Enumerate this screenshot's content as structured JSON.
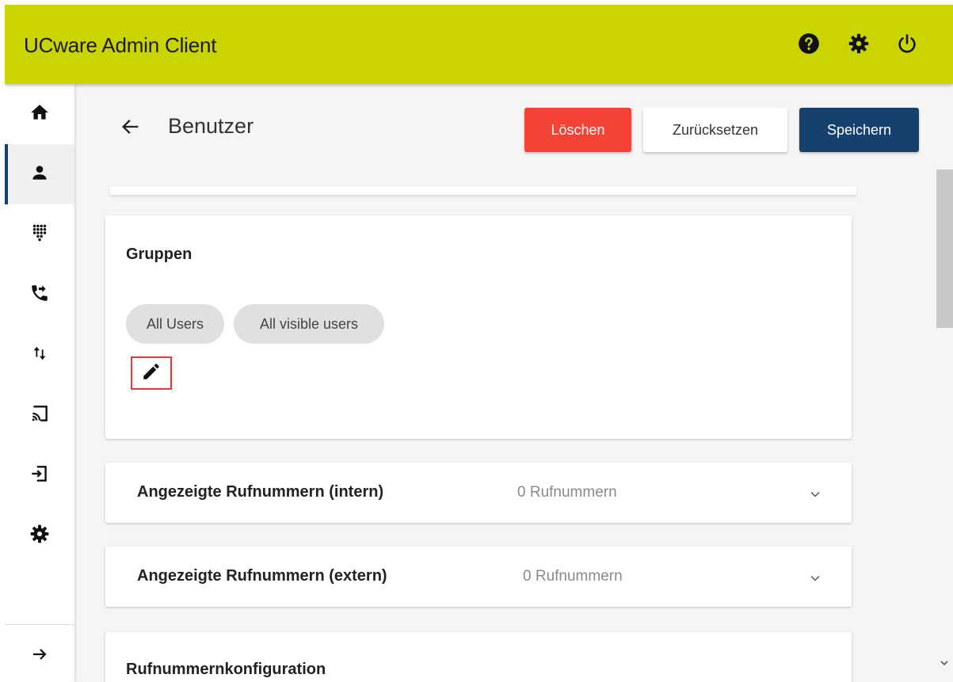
{
  "app": {
    "title": "UCware Admin Client",
    "colors": {
      "topbar": "#cad400",
      "accent": "#15416e",
      "danger": "#f44336",
      "highlight": "#e53935"
    }
  },
  "topbar": {
    "icons": [
      "help-icon",
      "settings-icon",
      "power-icon"
    ]
  },
  "sidebar": {
    "items": [
      {
        "icon": "home-icon",
        "active": false
      },
      {
        "icon": "user-icon",
        "active": true
      },
      {
        "icon": "dialpad-icon",
        "active": false
      },
      {
        "icon": "phone-forward-icon",
        "active": false
      },
      {
        "icon": "import-export-icon",
        "active": false
      },
      {
        "icon": "cast-icon",
        "active": false
      },
      {
        "icon": "login-icon",
        "active": false
      },
      {
        "icon": "settings-icon",
        "active": false
      }
    ],
    "expand_icon": "arrow-right-icon"
  },
  "page": {
    "title": "Benutzer",
    "back_icon": "arrow-left-icon"
  },
  "toolbar": {
    "delete_label": "Löschen",
    "reset_label": "Zurücksetzen",
    "save_label": "Speichern"
  },
  "groups": {
    "title": "Gruppen",
    "chips": [
      "All Users",
      "All visible users"
    ],
    "edit_icon": "pencil-icon"
  },
  "sections": [
    {
      "title": "Angezeigte Rufnummern (intern)",
      "count": "0 Rufnummern"
    },
    {
      "title": "Angezeigte Rufnummern (extern)",
      "count": "0 Rufnummern"
    }
  ],
  "bottom_section": {
    "title": "Rufnummernkonfiguration"
  }
}
